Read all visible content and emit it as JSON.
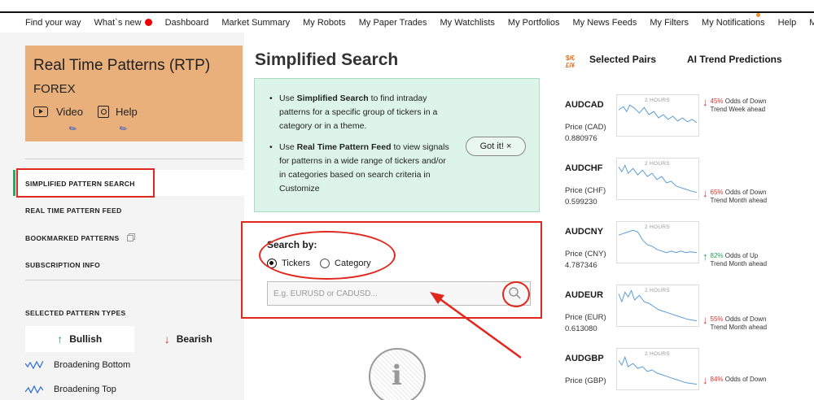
{
  "nav": {
    "items": [
      "Find your way",
      "What`s new",
      "Dashboard",
      "Market Summary",
      "My Robots",
      "My Paper Trades",
      "My Watchlists",
      "My Portfolios",
      "My News Feeds",
      "My Filters",
      "My Notifications",
      "Help",
      "My Br"
    ]
  },
  "rtp": {
    "title": "Real Time Patterns (RTP)",
    "subtitle": "FOREX",
    "video_label": "Video",
    "help_label": "Help"
  },
  "menu": {
    "simplified": "SIMPLIFIED PATTERN SEARCH",
    "realtime": "REAL TIME PATTERN FEED",
    "bookmarked": "BOOKMARKED PATTERNS",
    "subscription": "SUBSCRIPTION INFO"
  },
  "pattern_types": {
    "heading": "SELECTED PATTERN TYPES",
    "bullish": "Bullish",
    "bearish": "Bearish",
    "items": [
      "Broadening Bottom",
      "Broadening Top"
    ]
  },
  "main": {
    "title": "Simplified Search",
    "bullet1_pre": "Use ",
    "bullet1_bold": "Simplified Search",
    "bullet1_post": " to find intraday patterns for a specific group of tickers in a category or in a theme.",
    "bullet2_pre": "Use ",
    "bullet2_bold": "Real Time Pattern Feed",
    "bullet2_post": " to view signals for patterns in a wide range of tickers and/or in categories based on search criteria in Customize",
    "gotit": "Got it! ×",
    "search_by": "Search by:",
    "opt_tickers": "Tickers",
    "opt_category": "Category",
    "search_placeholder": "E.g. EURUSD or CADUSD...",
    "info_glyph": "i"
  },
  "right": {
    "currency_icon_top": "$/€",
    "currency_icon_bottom": "£/¥",
    "selected_pairs": "Selected Pairs",
    "ai_trend": "AI Trend Predictions",
    "spark_tag": "2 HOURS",
    "pairs": [
      {
        "name": "AUDCAD",
        "price_label": "Price (CAD)",
        "price": "0.880976",
        "pct": "45%",
        "odds": " Odds of Down",
        "horizon": "Trend Week ahead",
        "dir": "down"
      },
      {
        "name": "AUDCHF",
        "price_label": "Price (CHF)",
        "price": "0.599230",
        "pct": "65%",
        "odds": " Odds of Down",
        "horizon": "Trend Month ahead",
        "dir": "down"
      },
      {
        "name": "AUDCNY",
        "price_label": "Price (CNY)",
        "price": "4.787346",
        "pct": "82%",
        "odds": " Odds of Up",
        "horizon": "Trend Month ahead",
        "dir": "up"
      },
      {
        "name": "AUDEUR",
        "price_label": "Price (EUR)",
        "price": "0.613080",
        "pct": "55%",
        "odds": " Odds of Down",
        "horizon": "Trend Month ahead",
        "dir": "down"
      },
      {
        "name": "AUDGBP",
        "price_label": "Price (GBP)",
        "price": "",
        "pct": "84%",
        "odds": " Odds of Down",
        "horizon": "",
        "dir": "down"
      }
    ]
  },
  "colors": {
    "accent_green": "#2aa86a",
    "card_orange": "#e9b07c",
    "annotation_red": "#e0281e",
    "info_mint": "#ddf4ea"
  }
}
